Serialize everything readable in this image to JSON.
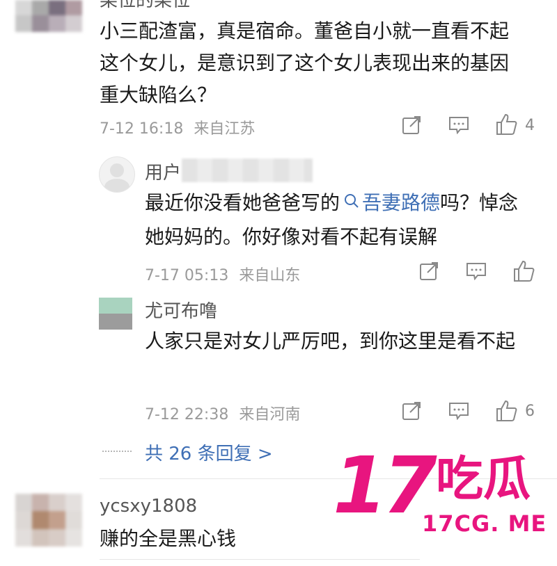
{
  "comments": [
    {
      "author": "某位的某位",
      "text": "小三配渣富，真是宿命。董爸自小就一直看不起这个女儿，是意识到了这个女儿表现出来的基因重大缺陷么？",
      "time": "7-12 16:18",
      "location": "来自江苏",
      "likes": "4",
      "replies": [
        {
          "author": "用户",
          "text_before": "最近你没看她爸爸写的",
          "link": "吾妻路德",
          "text_after": "吗？悼念她妈妈的。你好像对看不起有误解",
          "time": "7-17 05:13",
          "location": "来自山东",
          "likes": ""
        },
        {
          "author": "尤可布噜",
          "text": "人家只是对女儿严厉吧，到你这里是看不起",
          "time": "7-12 22:38",
          "location": "来自河南",
          "likes": "6"
        }
      ],
      "more_replies": "共 26 条回复 >"
    },
    {
      "author": "ycsxy1808",
      "text": "赚的全是黑心钱"
    }
  ],
  "watermark": {
    "logo_number": "17",
    "logo_text": "吃瓜",
    "domain": "17CG. ME",
    "color": "#e8157f"
  }
}
